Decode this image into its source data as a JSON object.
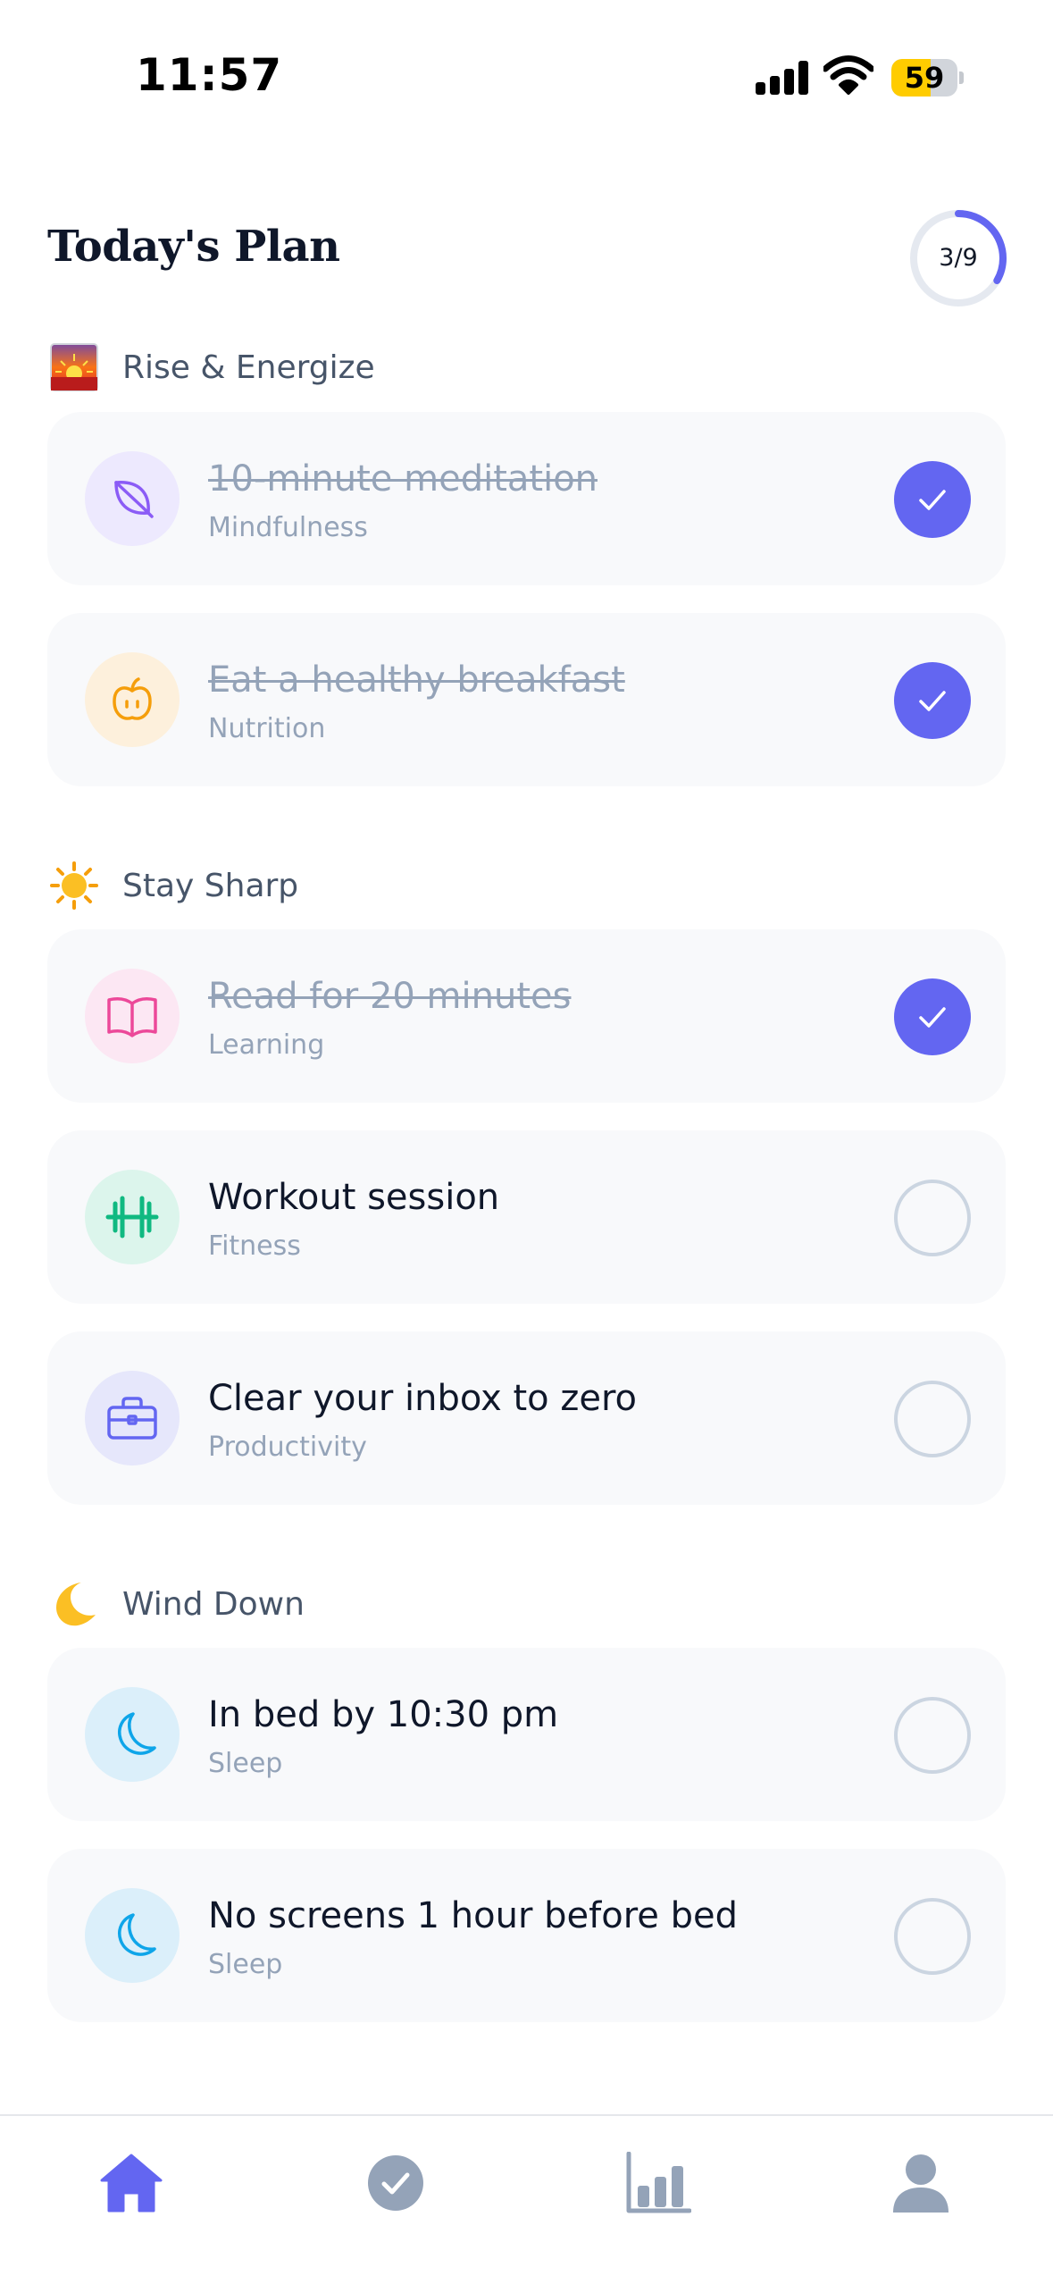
{
  "status_bar": {
    "time": "11:57",
    "battery_level": "59",
    "battery_fraction": 0.59
  },
  "header": {
    "title": "Today's Plan",
    "progress_text": "3/9",
    "progress_fraction": 0.333
  },
  "sections": [
    {
      "label": "Rise & Energize",
      "icon": "sunrise-icon",
      "tasks": [
        {
          "title": "10-minute meditation",
          "category": "Mindfulness",
          "icon": "leaf-icon",
          "done": true,
          "icon_color": "#8b5cf6",
          "icon_bg": "#ede9fe"
        },
        {
          "title": "Eat a healthy breakfast",
          "category": "Nutrition",
          "icon": "apple-icon",
          "done": true,
          "icon_color": "#f59e0b",
          "icon_bg": "#fdf0dc"
        }
      ]
    },
    {
      "label": "Stay Sharp",
      "icon": "sun-icon",
      "tasks": [
        {
          "title": "Read for 20 minutes",
          "category": "Learning",
          "icon": "book-icon",
          "done": true,
          "icon_color": "#ec4899",
          "icon_bg": "#fce7f3"
        },
        {
          "title": "Workout session",
          "category": "Fitness",
          "icon": "dumbbell-icon",
          "done": false,
          "icon_color": "#10b981",
          "icon_bg": "#dcf5ec"
        },
        {
          "title": "Clear your inbox to zero",
          "category": "Productivity",
          "icon": "briefcase-icon",
          "done": false,
          "icon_color": "#6366f1",
          "icon_bg": "#e6e7fb"
        }
      ]
    },
    {
      "label": "Wind Down",
      "icon": "crescent-moon-icon",
      "tasks": [
        {
          "title": "In bed by 10:30 pm",
          "category": "Sleep",
          "icon": "moon-icon",
          "done": false,
          "icon_color": "#0ea5e9",
          "icon_bg": "#dbeffa"
        },
        {
          "title": "No screens 1 hour before bed",
          "category": "Sleep",
          "icon": "moon-icon",
          "done": false,
          "icon_color": "#0ea5e9",
          "icon_bg": "#dbeffa"
        }
      ]
    }
  ],
  "tab_bar": {
    "tabs": [
      {
        "name": "home",
        "icon": "home-icon",
        "active": true
      },
      {
        "name": "tasks",
        "icon": "check-circle-icon",
        "active": false
      },
      {
        "name": "stats",
        "icon": "bar-chart-icon",
        "active": false
      },
      {
        "name": "profile",
        "icon": "person-icon",
        "active": false
      }
    ]
  },
  "colors": {
    "accent": "#6366f1",
    "muted": "#94a3b8",
    "card": "#f8f9fb"
  }
}
